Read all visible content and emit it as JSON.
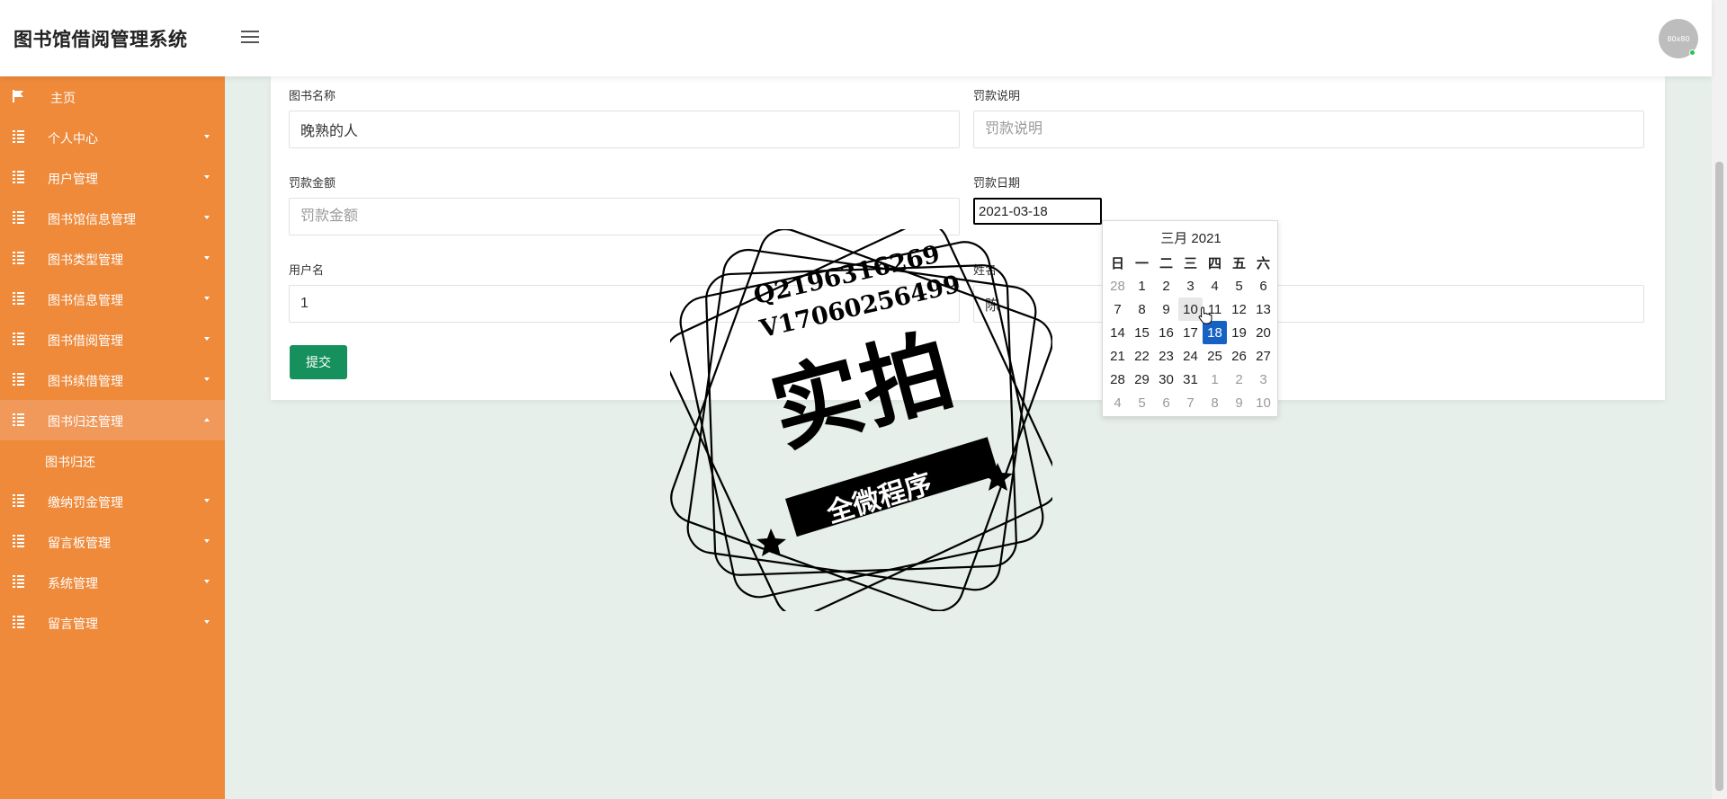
{
  "app": {
    "title": "图书馆借阅管理系统",
    "avatar_text": "80x80"
  },
  "sidebar": {
    "items": [
      {
        "label": "主页",
        "icon": "flag-icon",
        "expandable": false
      },
      {
        "label": "个人中心",
        "icon": "grid-icon",
        "expandable": true
      },
      {
        "label": "用户管理",
        "icon": "grid-icon",
        "expandable": true
      },
      {
        "label": "图书馆信息管理",
        "icon": "grid-icon",
        "expandable": true
      },
      {
        "label": "图书类型管理",
        "icon": "grid-icon",
        "expandable": true
      },
      {
        "label": "图书信息管理",
        "icon": "grid-icon",
        "expandable": true
      },
      {
        "label": "图书借阅管理",
        "icon": "grid-icon",
        "expandable": true
      },
      {
        "label": "图书续借管理",
        "icon": "grid-icon",
        "expandable": true
      },
      {
        "label": "图书归还管理",
        "icon": "grid-icon",
        "expandable": true,
        "open": true
      },
      {
        "label": "缴纳罚金管理",
        "icon": "grid-icon",
        "expandable": true
      },
      {
        "label": "留言板管理",
        "icon": "grid-icon",
        "expandable": true
      },
      {
        "label": "系统管理",
        "icon": "grid-icon",
        "expandable": true
      },
      {
        "label": "留言管理",
        "icon": "grid-icon",
        "expandable": true
      }
    ],
    "subitem": "图书归还"
  },
  "form": {
    "book_name": {
      "label": "图书名称",
      "value": "晚熟的人"
    },
    "fine_desc": {
      "label": "罚款说明",
      "placeholder": "罚款说明"
    },
    "fine_amount": {
      "label": "罚款金额",
      "placeholder": "罚款金额"
    },
    "fine_date": {
      "label": "罚款日期",
      "value": "2021-03-18"
    },
    "username": {
      "label": "用户名",
      "value": "1"
    },
    "name": {
      "label": "姓名",
      "value": "陈"
    },
    "submit": "提交"
  },
  "calendar": {
    "title": "三月 2021",
    "weekdays": [
      "日",
      "一",
      "二",
      "三",
      "四",
      "五",
      "六"
    ],
    "days": [
      [
        "28",
        "1",
        "2",
        "3",
        "4",
        "5",
        "6"
      ],
      [
        "7",
        "8",
        "9",
        "10",
        "11",
        "12",
        "13"
      ],
      [
        "14",
        "15",
        "16",
        "17",
        "18",
        "19",
        "20"
      ],
      [
        "21",
        "22",
        "23",
        "24",
        "25",
        "26",
        "27"
      ],
      [
        "28",
        "29",
        "30",
        "31",
        "1",
        "2",
        "3"
      ],
      [
        "4",
        "5",
        "6",
        "7",
        "8",
        "9",
        "10"
      ]
    ],
    "selected": "18",
    "hovered": "10"
  },
  "stamp": {
    "line1": "Q2196316269",
    "line2": "V17060256499",
    "main": "实拍",
    "band": "全微程序"
  },
  "colors": {
    "sidebar": "#ee8a3a",
    "accent": "#16915d",
    "selected": "#1662c4"
  }
}
